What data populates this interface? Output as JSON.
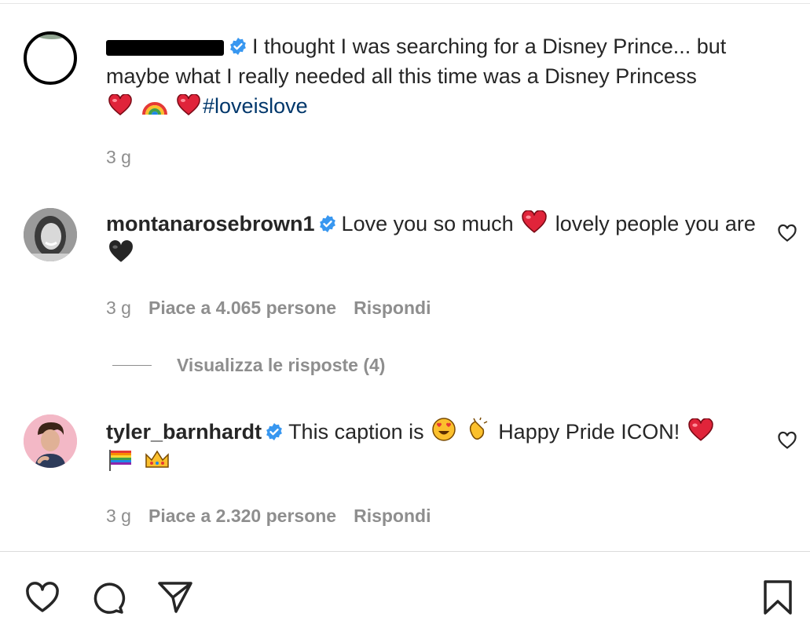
{
  "post": {
    "author_redacted": true,
    "caption": "I thought I was searching for a Disney Prince... but maybe what I really needed all this time was a Disney Princess",
    "hashtag": "#loveislove",
    "time": "3 g"
  },
  "comments": [
    {
      "username": "montanarosebrown1",
      "text_a": "Love you so much",
      "text_b": "lovely people you are",
      "time": "3 g",
      "likes": "Piace a 4.065 persone",
      "reply": "Rispondi",
      "view_replies": "Visualizza le risposte (4)"
    },
    {
      "username": "tyler_barnhardt",
      "text_a": "This caption is",
      "text_b": "Happy Pride ICON!",
      "time": "3 g",
      "likes": "Piace a 2.320 persone",
      "reply": "Rispondi"
    }
  ],
  "icons": {
    "verified": "verified-badge-icon",
    "like": "heart-outline-icon",
    "comment": "comment-bubble-icon",
    "share": "paper-plane-icon",
    "save": "bookmark-icon"
  },
  "colors": {
    "verified": "#3897f0",
    "hashtag": "#00376b",
    "muted": "#8e8e8e",
    "red_heart": "#e0243a",
    "black_heart": "#262626"
  }
}
